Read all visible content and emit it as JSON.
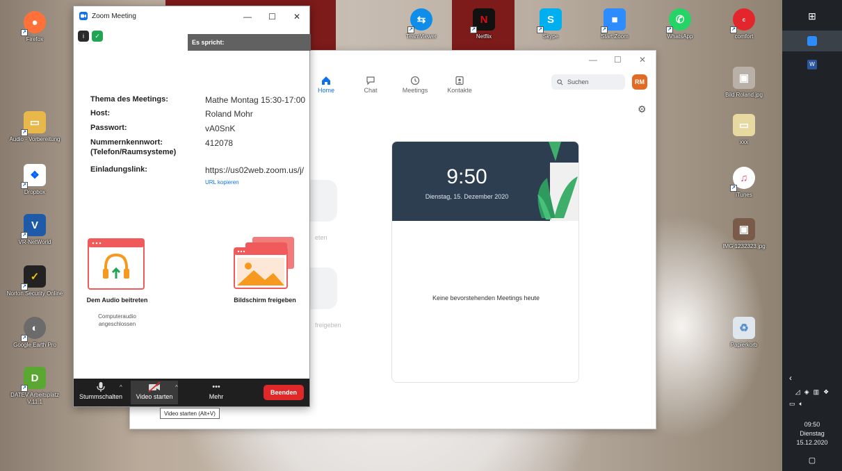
{
  "desktop": {
    "left_icons": [
      {
        "label": "Firefox",
        "icon": "firefox-icon",
        "color": "#ff7139"
      },
      {
        "label": "Audio - Vorbereitung",
        "icon": "folder-icon",
        "color": "#e8b84a"
      },
      {
        "label": "Dropbox",
        "icon": "dropbox-icon",
        "color": "#0061ff"
      },
      {
        "label": "VR-NetWorld",
        "icon": "vr-networld-icon",
        "color": "#1e5aa8"
      },
      {
        "label": "Norton Security Online",
        "icon": "norton-icon",
        "color": "#222222"
      },
      {
        "label": "Google Earth Pro",
        "icon": "google-earth-icon",
        "color": "#6b6b6b"
      },
      {
        "label": "DATEV Arbeitsplatz V.11.1",
        "icon": "datev-icon",
        "color": "#5aa832"
      }
    ],
    "top_icons": [
      {
        "label": "TeamViewer",
        "icon": "teamviewer-icon",
        "color": "#0e8ee9"
      },
      {
        "label": "Netflix",
        "icon": "netflix-icon",
        "color": "#111111"
      },
      {
        "label": "Skype",
        "icon": "skype-icon",
        "color": "#00aff0"
      },
      {
        "label": "Start Zoom",
        "icon": "zoom-icon",
        "color": "#2d8cff"
      },
      {
        "label": "WhatsApp",
        "icon": "whatsapp-icon",
        "color": "#25d366"
      },
      {
        "label": "comfort",
        "icon": "comfort-icon",
        "color": "#e3262c"
      }
    ],
    "right_icons": [
      {
        "label": "Bild Roland.jpg",
        "icon": "image-file-icon",
        "color": "#b9b0a8"
      },
      {
        "label": "xxx",
        "icon": "folder-icon",
        "color": "#e8d9a0"
      },
      {
        "label": "iTunes",
        "icon": "itunes-icon",
        "color": "#e84a7a"
      },
      {
        "label": "IMG 1232323.jpg",
        "icon": "image-file-icon",
        "color": "#7a5a48"
      },
      {
        "label": "Papierkorb",
        "icon": "recycle-bin-icon",
        "color": "#5a8ec8"
      }
    ]
  },
  "taskbar": {
    "time": "09:50",
    "day": "Dienstag",
    "date": "15.12.2020"
  },
  "zoom_main": {
    "nav": [
      {
        "label": "Home",
        "icon": "home-icon",
        "active": true
      },
      {
        "label": "Chat",
        "icon": "chat-icon",
        "active": false
      },
      {
        "label": "Meetings",
        "icon": "clock-icon",
        "active": false
      },
      {
        "label": "Kontakte",
        "icon": "contacts-icon",
        "active": false
      }
    ],
    "search_placeholder": "Suchen",
    "avatar_initials": "RM",
    "ghost_labels": [
      "eten",
      "freigeben"
    ],
    "clock_time": "9:50",
    "clock_date": "Dienstag, 15. Dezember 2020",
    "no_meetings": "Keine bevorstehenden Meetings heute",
    "accent": "#0e71eb"
  },
  "zoom_meeting": {
    "title": "Zoom Meeting",
    "speaking": "Es spricht:",
    "info": {
      "topic_label": "Thema des Meetings:",
      "topic": "Mathe Montag 15:30-17:00",
      "host_label": "Host:",
      "host": "Roland Mohr",
      "password_label": "Passwort:",
      "password": "vA0SnK",
      "numeric_label": "Nummernkennwort: (Telefon/Raumsysteme)",
      "numeric": "412078",
      "invite_label": "Einladungslink:",
      "invite": "https://us02web.zoom.us/j/",
      "copy_url": "URL kopieren"
    },
    "audio_join": "Dem Audio beitreten",
    "audio_status": "Computeraudio angeschlossen",
    "share_screen": "Bildschirm freigeben",
    "toolbar": {
      "mute": "Stummschalten",
      "video": "Video starten",
      "more": "Mehr",
      "end": "Beenden"
    },
    "tooltip": "Video starten (Alt+V)",
    "end_color": "#e02828"
  }
}
